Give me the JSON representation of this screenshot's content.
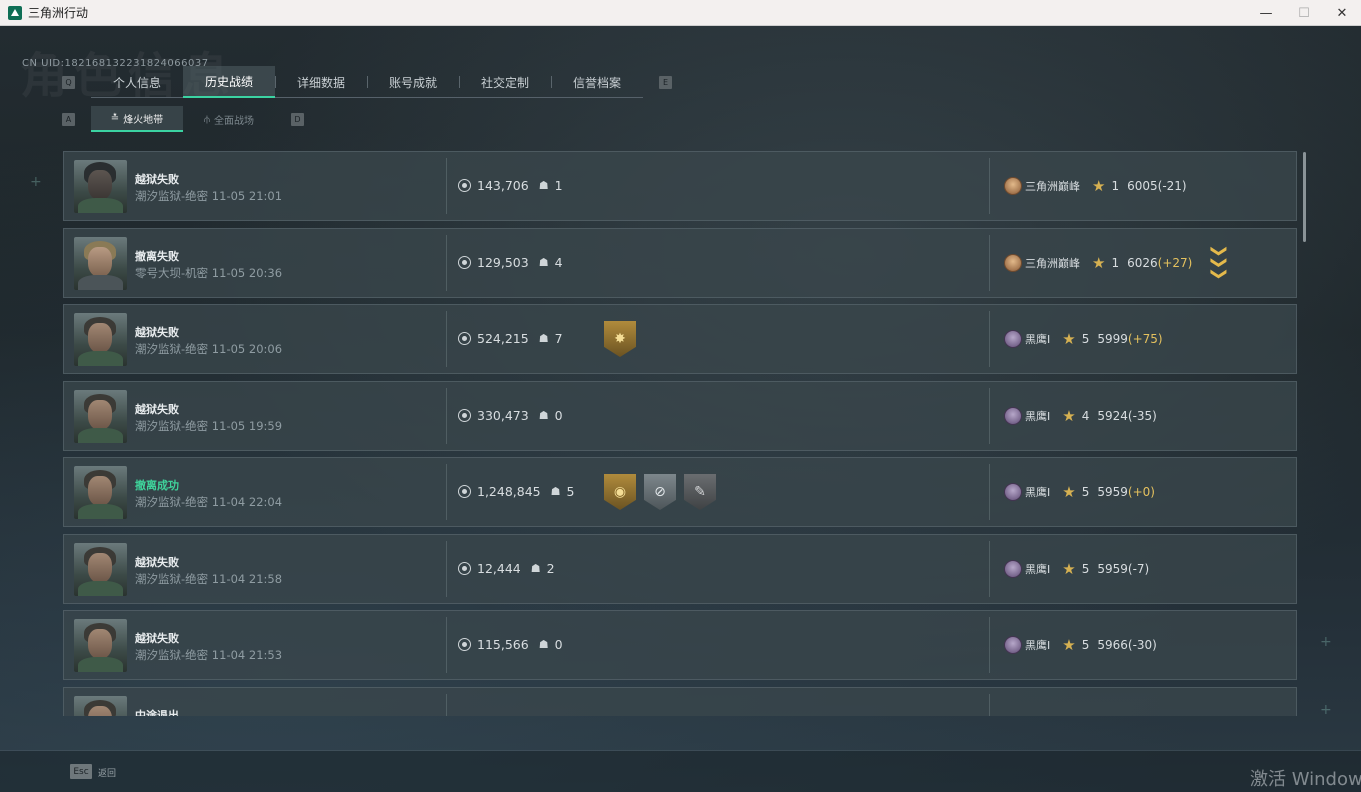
{
  "window": {
    "title": "三角洲行动",
    "minimize": "—",
    "maximize": "☐",
    "close": "✕"
  },
  "uid": "CN UID:182168132231824066037",
  "ghost_title": "角色信息",
  "tabs": {
    "left_key": "Q",
    "right_key": "E",
    "items": [
      {
        "label": "个人信息",
        "active": false
      },
      {
        "label": "历史战绩",
        "active": true
      },
      {
        "label": "详细数据",
        "active": false
      },
      {
        "label": "账号成就",
        "active": false
      },
      {
        "label": "社交定制",
        "active": false
      },
      {
        "label": "信誉档案",
        "active": false
      }
    ]
  },
  "subtabs": {
    "left_key": "A",
    "right_key": "D",
    "items": [
      {
        "label": "烽火地带",
        "icon": "≛",
        "active": true
      },
      {
        "label": "全面战场",
        "icon": "⫛",
        "active": false
      }
    ]
  },
  "records": [
    {
      "result": "越狱失败",
      "success": false,
      "map": "潮汐监狱-绝密 11-05 21:01",
      "value": "143,706",
      "kills": "1",
      "badges": [],
      "rank_name": "三角洲巅峰",
      "rank_type": "peak",
      "stars": "1",
      "score": "6005",
      "delta": "(-21)",
      "delta_pos": false,
      "chevron": false
    },
    {
      "result": "撤离失败",
      "success": false,
      "map": "零号大坝-机密 11-05 20:36",
      "value": "129,503",
      "kills": "4",
      "badges": [],
      "rank_name": "三角洲巅峰",
      "rank_type": "peak",
      "stars": "1",
      "score": "6026",
      "delta": "(+27)",
      "delta_pos": true,
      "chevron": true
    },
    {
      "result": "越狱失败",
      "success": false,
      "map": "潮汐监狱-绝密 11-05 20:06",
      "value": "524,215",
      "kills": "7",
      "badges": [
        {
          "type": "gold",
          "icon": "✸"
        }
      ],
      "rank_name": "黑鹰I",
      "rank_type": "blackhawk",
      "stars": "5",
      "score": "5999",
      "delta": "(+75)",
      "delta_pos": true,
      "chevron": false
    },
    {
      "result": "越狱失败",
      "success": false,
      "map": "潮汐监狱-绝密 11-05 19:59",
      "value": "330,473",
      "kills": "0",
      "badges": [],
      "rank_name": "黑鹰I",
      "rank_type": "blackhawk",
      "stars": "4",
      "score": "5924",
      "delta": "(-35)",
      "delta_pos": false,
      "chevron": false
    },
    {
      "result": "撤离成功",
      "success": true,
      "map": "潮汐监狱-绝密 11-04 22:04",
      "value": "1,248,845",
      "kills": "5",
      "badges": [
        {
          "type": "gold",
          "icon": "◉"
        },
        {
          "type": "silver",
          "icon": "⊘"
        },
        {
          "type": "dark",
          "icon": "✎"
        }
      ],
      "rank_name": "黑鹰I",
      "rank_type": "blackhawk",
      "stars": "5",
      "score": "5959",
      "delta": "(+0)",
      "delta_pos": true,
      "chevron": false
    },
    {
      "result": "越狱失败",
      "success": false,
      "map": "潮汐监狱-绝密 11-04 21:58",
      "value": "12,444",
      "kills": "2",
      "badges": [],
      "rank_name": "黑鹰I",
      "rank_type": "blackhawk",
      "stars": "5",
      "score": "5959",
      "delta": "(-7)",
      "delta_pos": false,
      "chevron": false
    },
    {
      "result": "越狱失败",
      "success": false,
      "map": "潮汐监狱-绝密 11-04 21:53",
      "value": "115,566",
      "kills": "0",
      "badges": [],
      "rank_name": "黑鹰I",
      "rank_type": "blackhawk",
      "stars": "5",
      "score": "5966",
      "delta": "(-30)",
      "delta_pos": false,
      "chevron": false
    },
    {
      "result": "中途退出",
      "success": false,
      "map": "",
      "value": "",
      "kills": "",
      "badges": [],
      "rank_name": "",
      "rank_type": "blackhawk",
      "stars": "",
      "score": "",
      "delta": "",
      "delta_pos": false,
      "chevron": false
    }
  ],
  "footer": {
    "esc_key": "Esc",
    "esc_label": "返回",
    "watermark": "激活 Windows"
  },
  "colors": {
    "accent": "#3bd3a2",
    "success": "#3fd39b",
    "gold": "#e4c15e"
  }
}
